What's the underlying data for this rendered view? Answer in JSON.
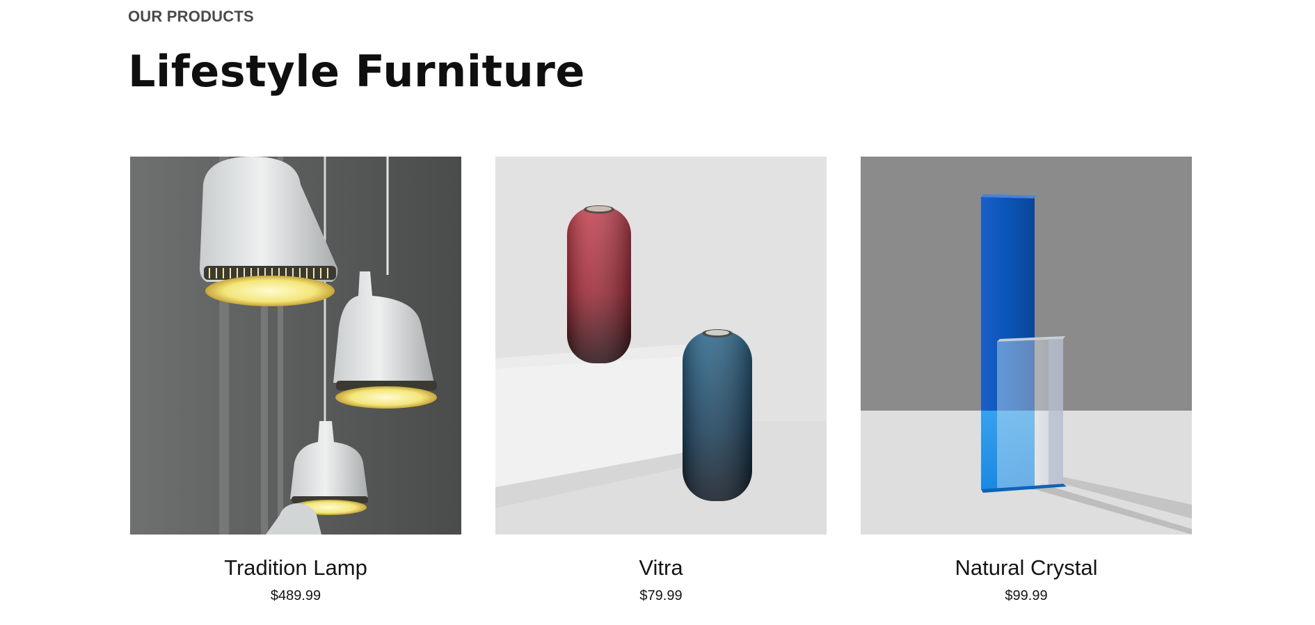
{
  "section": {
    "label": "OUR PRODUCTS",
    "title": "Lifestyle Furniture"
  },
  "products": [
    {
      "name": "Tradition Lamp",
      "price": "$489.99",
      "image": "pendant-lamps-photo"
    },
    {
      "name": "Vitra",
      "price": "$79.99",
      "image": "ceramic-vases-photo"
    },
    {
      "name": "Natural Crystal",
      "price": "$99.99",
      "image": "acrylic-crystal-photo"
    }
  ]
}
